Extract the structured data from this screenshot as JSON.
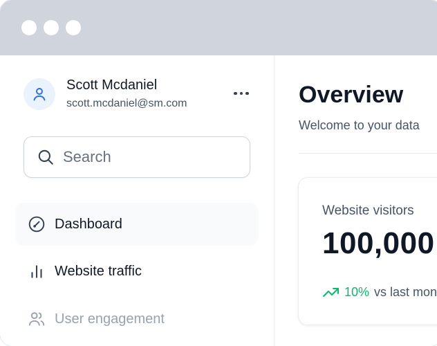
{
  "window": {
    "controls": [
      "close",
      "minimize",
      "maximize"
    ]
  },
  "user": {
    "name": "Scott Mcdaniel",
    "email": "scott.mcdaniel@sm.com",
    "avatar_icon": "user-icon",
    "menu_icon": "more-horizontal-icon"
  },
  "search": {
    "placeholder": "Search",
    "icon": "search-icon"
  },
  "sidebar": {
    "items": [
      {
        "label": "Dashboard",
        "icon": "dashboard-gauge-icon",
        "active": true
      },
      {
        "label": "Website traffic",
        "icon": "bar-chart-icon",
        "active": false
      },
      {
        "label": "User engagement",
        "icon": "users-icon",
        "active": false
      }
    ]
  },
  "main": {
    "title": "Overview",
    "subtitle": "Welcome to your data",
    "card": {
      "label": "Website visitors",
      "value": "100,000",
      "trend_pct": "10%",
      "trend_text": "vs last month",
      "trend_icon": "trend-up-icon"
    }
  },
  "colors": {
    "titlebar": "#d0d5dd",
    "accent_positive": "#12b76a",
    "avatar_bg": "#eaf2fc",
    "avatar_icon": "#2e6fd8"
  }
}
